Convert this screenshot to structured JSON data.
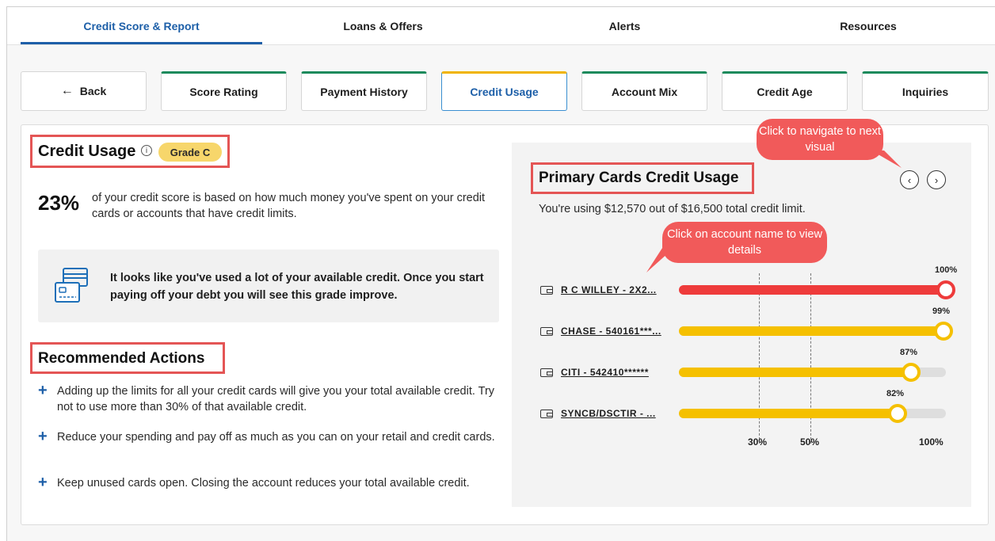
{
  "topnav": {
    "tabs": [
      {
        "label": "Credit Score & Report",
        "active": true
      },
      {
        "label": "Loans & Offers",
        "active": false
      },
      {
        "label": "Alerts",
        "active": false
      },
      {
        "label": "Resources",
        "active": false
      }
    ]
  },
  "subtabs": {
    "back": "Back",
    "items": [
      "Score Rating",
      "Payment History",
      "Credit Usage",
      "Account Mix",
      "Credit Age",
      "Inquiries"
    ],
    "active": "Credit Usage"
  },
  "usage": {
    "title": "Credit Usage",
    "info_icon": "info-icon",
    "grade": "Grade C",
    "percent": "23%",
    "description": "of your credit score is based on how much money you've spent on your credit cards or accounts that have credit limits."
  },
  "notice": {
    "icon": "credit-card-icon",
    "text": "It looks like you've used a lot of your available credit. Once you start paying off your debt you will see this grade improve."
  },
  "recommended": {
    "title": "Recommended Actions",
    "items": [
      "Adding up the limits for all your credit cards will give you your total available credit. Try not to use more than 30% of that available credit.",
      "Reduce your spending and pay off as much as you can on your retail and credit cards.",
      "Keep unused cards open. Closing the account reduces your total available credit."
    ]
  },
  "primary": {
    "title": "Primary Cards Credit Usage",
    "summary": "You're using $12,570 out of $16,500 total credit limit.",
    "prev_icon": "chevron-left-icon",
    "next_icon": "chevron-right-icon",
    "callout_nav": "Click to navigate to next visual",
    "callout_account": "Click on account name to view details",
    "accounts": [
      {
        "name": "R C WILLEY - 2X2...",
        "usage": 100,
        "label": "100%",
        "color": "#ee3b3b"
      },
      {
        "name": "CHASE - 540161***...",
        "usage": 99,
        "label": "99%",
        "color": "#f5c000"
      },
      {
        "name": "CITI - 542410******",
        "usage": 87,
        "label": "87%",
        "color": "#f5c000"
      },
      {
        "name": "SYNCB/DSCTIR - ...",
        "usage": 82,
        "label": "82%",
        "color": "#f5c000"
      }
    ],
    "axis_ticks": [
      "30%",
      "50%",
      "100%"
    ]
  }
}
